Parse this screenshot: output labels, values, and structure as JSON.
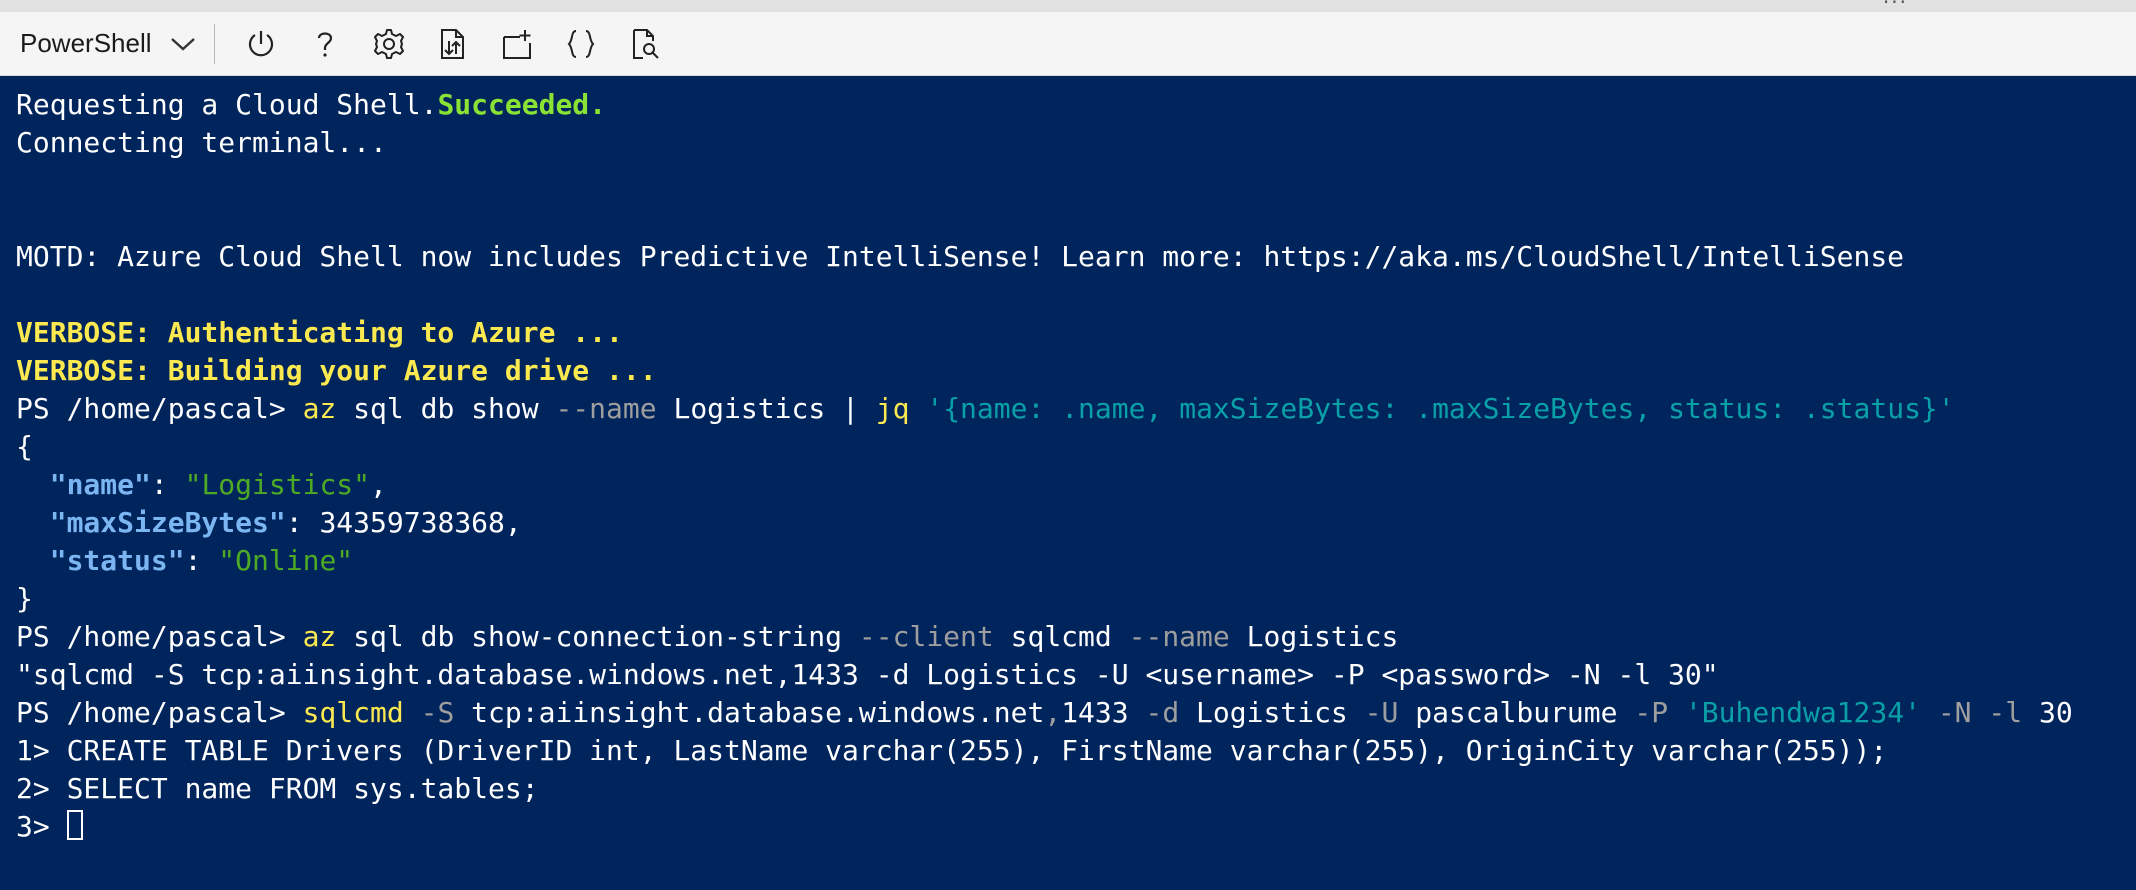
{
  "toolbar": {
    "shell_type": "PowerShell",
    "buttons": [
      {
        "id": "restart",
        "icon": "power-icon"
      },
      {
        "id": "help",
        "icon": "question-icon"
      },
      {
        "id": "settings",
        "icon": "gear-icon"
      },
      {
        "id": "upload-download",
        "icon": "file-transfer-icon"
      },
      {
        "id": "new-session",
        "icon": "new-session-icon"
      },
      {
        "id": "editor",
        "icon": "braces-icon"
      },
      {
        "id": "web-preview",
        "icon": "web-preview-icon"
      }
    ]
  },
  "colors": {
    "terminal_bg": "#00245c",
    "success_green": "#8ae234",
    "verbose_yellow": "#fce94f",
    "param_gray": "#9e9e9e",
    "string_teal": "#0aa0a8",
    "json_key_blue": "#7cb6f2",
    "json_string_green": "#4eaa25"
  },
  "terminal": {
    "line1": {
      "a": "Requesting a Cloud Shell.",
      "b": "Succeeded."
    },
    "line2": "Connecting terminal...",
    "motd": "MOTD: Azure Cloud Shell now includes Predictive IntelliSense! Learn more: https://aka.ms/CloudShell/IntelliSense",
    "verbose1": "VERBOSE: Authenticating to Azure ...",
    "verbose2": "VERBOSE: Building your Azure drive ...",
    "cmd1": {
      "prompt": "PS /home/pascal> ",
      "cmd": "az",
      "args1": " sql db show ",
      "param1": "--name",
      "args2": " Logistics | ",
      "cmd2": "jq",
      "space": " ",
      "str": "'{name: .name, maxSizeBytes: .maxSizeBytes, status: .status}'"
    },
    "json": {
      "open": "{",
      "indent": "  ",
      "key1": "\"name\"",
      "colon": ": ",
      "val1": "\"Logistics\"",
      "comma": ",",
      "key2": "\"maxSizeBytes\"",
      "val2": "34359738368",
      "key3": "\"status\"",
      "val3": "\"Online\"",
      "close": "}"
    },
    "cmd2": {
      "prompt": "PS /home/pascal> ",
      "cmd": "az",
      "args1": " sql db show-connection-string ",
      "param1": "--client",
      "args2": " sqlcmd ",
      "param2": "--name",
      "args3": " Logistics"
    },
    "conn_output": "\"sqlcmd -S tcp:aiinsight.database.windows.net,1433 -d Logistics -U <username> -P <password> -N -l 30\"",
    "cmd3": {
      "prompt": "PS /home/pascal> ",
      "cmd": "sqlcmd",
      "sp": " ",
      "p_s": "-S",
      "host": " tcp:aiinsight.database.windows.net",
      "comma": ",",
      "port": "1433 ",
      "p_d": "-d",
      "db": " Logistics ",
      "p_u": "-U",
      "user": " pascalburume ",
      "p_p": "-P",
      "pw": "'Buhendwa1234'",
      "p_n": "-N",
      "p_l": "-l",
      "timeout": " 30"
    },
    "sql1": "1> CREATE TABLE Drivers (DriverID int, LastName varchar(255), FirstName varchar(255), OriginCity varchar(255));",
    "sql2": "2> SELECT name FROM sys.tables;",
    "sql3_prompt": "3> "
  }
}
